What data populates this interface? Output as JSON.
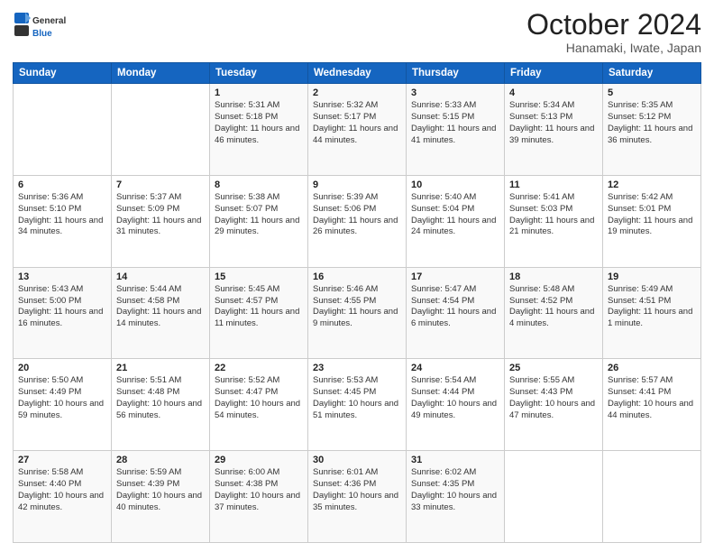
{
  "logo": {
    "general": "General",
    "blue": "Blue"
  },
  "header": {
    "month": "October 2024",
    "location": "Hanamaki, Iwate, Japan"
  },
  "weekdays": [
    "Sunday",
    "Monday",
    "Tuesday",
    "Wednesday",
    "Thursday",
    "Friday",
    "Saturday"
  ],
  "weeks": [
    [
      null,
      null,
      {
        "day": 1,
        "sunrise": "5:31 AM",
        "sunset": "5:18 PM",
        "daylight": "11 hours and 46 minutes."
      },
      {
        "day": 2,
        "sunrise": "5:32 AM",
        "sunset": "5:17 PM",
        "daylight": "11 hours and 44 minutes."
      },
      {
        "day": 3,
        "sunrise": "5:33 AM",
        "sunset": "5:15 PM",
        "daylight": "11 hours and 41 minutes."
      },
      {
        "day": 4,
        "sunrise": "5:34 AM",
        "sunset": "5:13 PM",
        "daylight": "11 hours and 39 minutes."
      },
      {
        "day": 5,
        "sunrise": "5:35 AM",
        "sunset": "5:12 PM",
        "daylight": "11 hours and 36 minutes."
      }
    ],
    [
      {
        "day": 6,
        "sunrise": "5:36 AM",
        "sunset": "5:10 PM",
        "daylight": "11 hours and 34 minutes."
      },
      {
        "day": 7,
        "sunrise": "5:37 AM",
        "sunset": "5:09 PM",
        "daylight": "11 hours and 31 minutes."
      },
      {
        "day": 8,
        "sunrise": "5:38 AM",
        "sunset": "5:07 PM",
        "daylight": "11 hours and 29 minutes."
      },
      {
        "day": 9,
        "sunrise": "5:39 AM",
        "sunset": "5:06 PM",
        "daylight": "11 hours and 26 minutes."
      },
      {
        "day": 10,
        "sunrise": "5:40 AM",
        "sunset": "5:04 PM",
        "daylight": "11 hours and 24 minutes."
      },
      {
        "day": 11,
        "sunrise": "5:41 AM",
        "sunset": "5:03 PM",
        "daylight": "11 hours and 21 minutes."
      },
      {
        "day": 12,
        "sunrise": "5:42 AM",
        "sunset": "5:01 PM",
        "daylight": "11 hours and 19 minutes."
      }
    ],
    [
      {
        "day": 13,
        "sunrise": "5:43 AM",
        "sunset": "5:00 PM",
        "daylight": "11 hours and 16 minutes."
      },
      {
        "day": 14,
        "sunrise": "5:44 AM",
        "sunset": "4:58 PM",
        "daylight": "11 hours and 14 minutes."
      },
      {
        "day": 15,
        "sunrise": "5:45 AM",
        "sunset": "4:57 PM",
        "daylight": "11 hours and 11 minutes."
      },
      {
        "day": 16,
        "sunrise": "5:46 AM",
        "sunset": "4:55 PM",
        "daylight": "11 hours and 9 minutes."
      },
      {
        "day": 17,
        "sunrise": "5:47 AM",
        "sunset": "4:54 PM",
        "daylight": "11 hours and 6 minutes."
      },
      {
        "day": 18,
        "sunrise": "5:48 AM",
        "sunset": "4:52 PM",
        "daylight": "11 hours and 4 minutes."
      },
      {
        "day": 19,
        "sunrise": "5:49 AM",
        "sunset": "4:51 PM",
        "daylight": "11 hours and 1 minute."
      }
    ],
    [
      {
        "day": 20,
        "sunrise": "5:50 AM",
        "sunset": "4:49 PM",
        "daylight": "10 hours and 59 minutes."
      },
      {
        "day": 21,
        "sunrise": "5:51 AM",
        "sunset": "4:48 PM",
        "daylight": "10 hours and 56 minutes."
      },
      {
        "day": 22,
        "sunrise": "5:52 AM",
        "sunset": "4:47 PM",
        "daylight": "10 hours and 54 minutes."
      },
      {
        "day": 23,
        "sunrise": "5:53 AM",
        "sunset": "4:45 PM",
        "daylight": "10 hours and 51 minutes."
      },
      {
        "day": 24,
        "sunrise": "5:54 AM",
        "sunset": "4:44 PM",
        "daylight": "10 hours and 49 minutes."
      },
      {
        "day": 25,
        "sunrise": "5:55 AM",
        "sunset": "4:43 PM",
        "daylight": "10 hours and 47 minutes."
      },
      {
        "day": 26,
        "sunrise": "5:57 AM",
        "sunset": "4:41 PM",
        "daylight": "10 hours and 44 minutes."
      }
    ],
    [
      {
        "day": 27,
        "sunrise": "5:58 AM",
        "sunset": "4:40 PM",
        "daylight": "10 hours and 42 minutes."
      },
      {
        "day": 28,
        "sunrise": "5:59 AM",
        "sunset": "4:39 PM",
        "daylight": "10 hours and 40 minutes."
      },
      {
        "day": 29,
        "sunrise": "6:00 AM",
        "sunset": "4:38 PM",
        "daylight": "10 hours and 37 minutes."
      },
      {
        "day": 30,
        "sunrise": "6:01 AM",
        "sunset": "4:36 PM",
        "daylight": "10 hours and 35 minutes."
      },
      {
        "day": 31,
        "sunrise": "6:02 AM",
        "sunset": "4:35 PM",
        "daylight": "10 hours and 33 minutes."
      },
      null,
      null
    ]
  ]
}
